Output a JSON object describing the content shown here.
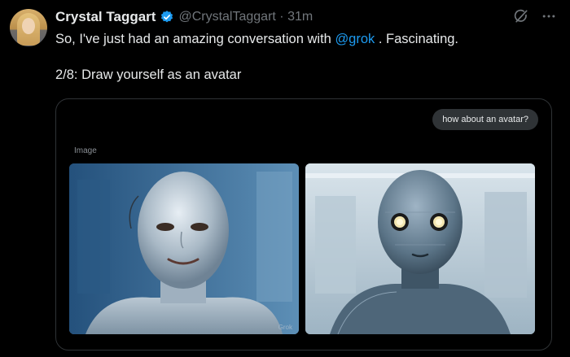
{
  "tweet": {
    "author_name": "Crystal Taggart",
    "handle_time": "@CrystalTaggart · 31m",
    "line1_before": "So, I've just had an amazing conversation with ",
    "mention": "@grok",
    "line1_after": " . Fascinating.",
    "line2": "2/8: Draw yourself as an avatar"
  },
  "card": {
    "chat_bubble": "how about an avatar?",
    "image_label": "Image",
    "left_image_watermark": "Grok"
  },
  "icons": {
    "verified": "verified-badge-icon",
    "grok_action": "grok-icon",
    "more": "more-icon"
  },
  "colors": {
    "background": "#000000",
    "text": "#e7e9ea",
    "secondary_text": "#71767b",
    "accent": "#1d9bf0",
    "border": "#2f3336"
  }
}
